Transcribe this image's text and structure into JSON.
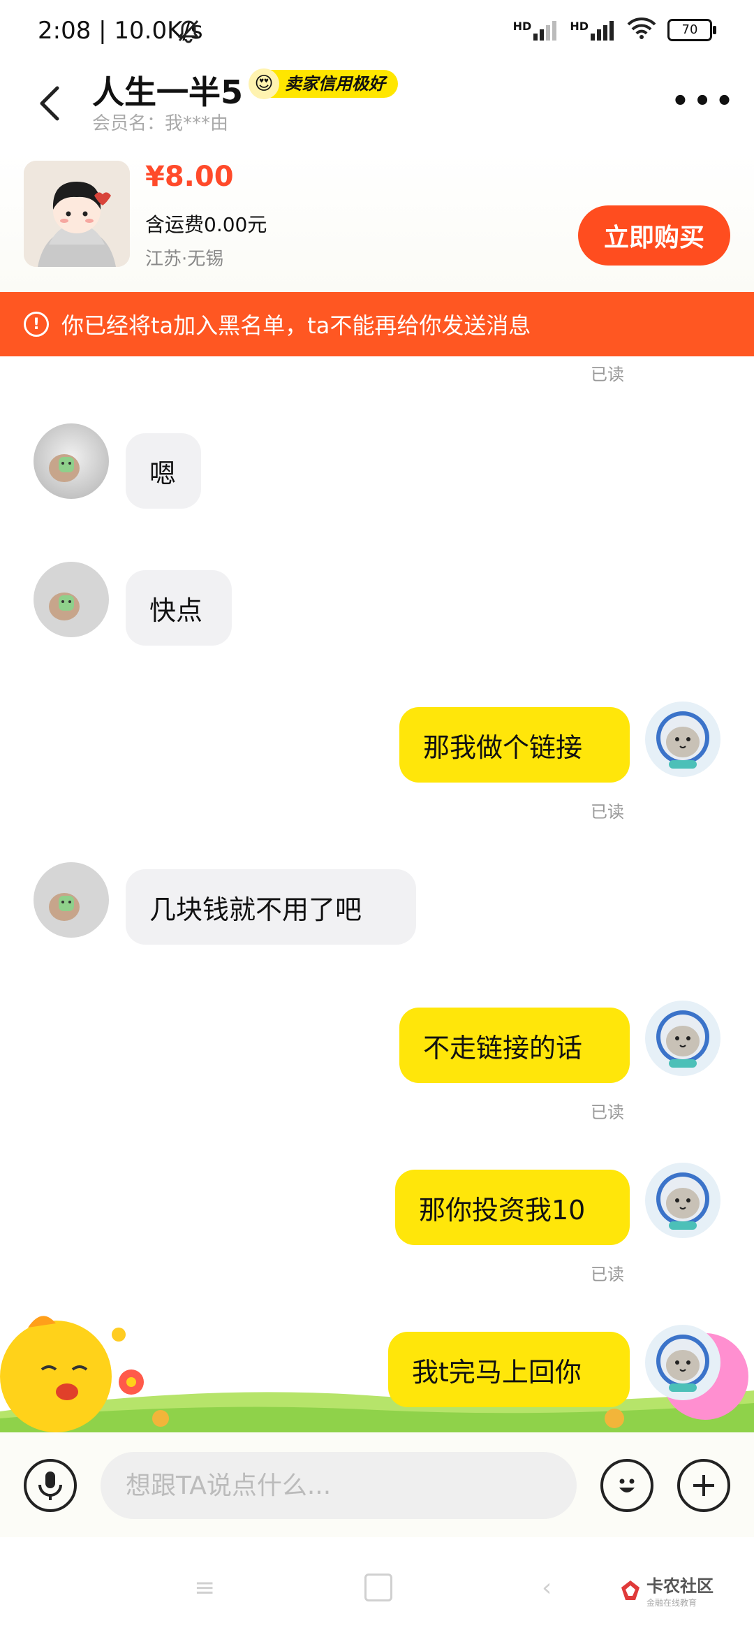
{
  "status_bar": {
    "time": "2:08 | 10.0K/s",
    "signal1": "HD",
    "signal2": "HD",
    "battery": "70"
  },
  "header": {
    "seller_name": "人生一半5",
    "credit_badge": "卖家信用极好",
    "member_label": "会员名：我***由"
  },
  "product": {
    "price": "¥8.00",
    "shipping": "含运费0.00元",
    "location": "江苏·无锡",
    "buy_button": "立即购买"
  },
  "banner": {
    "text": "你已经将ta加入黑名单，ta不能再给你发送消息"
  },
  "chat": {
    "top_read": "已读",
    "messages": [
      {
        "from": "other",
        "text": "嗯"
      },
      {
        "from": "other",
        "text": "快点"
      },
      {
        "from": "self",
        "text": "那我做个链接",
        "status": "已读"
      },
      {
        "from": "other",
        "text": "几块钱就不用了吧"
      },
      {
        "from": "self",
        "text": "不走链接的话",
        "status": "已读"
      },
      {
        "from": "self",
        "text": "那你投资我10",
        "status": "已读"
      },
      {
        "from": "self",
        "text": "我t完马上回你"
      }
    ]
  },
  "input": {
    "placeholder": "想跟TA说点什么..."
  },
  "watermark": {
    "text": "卡农社区",
    "sub": "金融在线教育"
  },
  "colors": {
    "accent_orange": "#ff5722",
    "bubble_yellow": "#ffe60a",
    "price_red": "#ff4a2a"
  }
}
